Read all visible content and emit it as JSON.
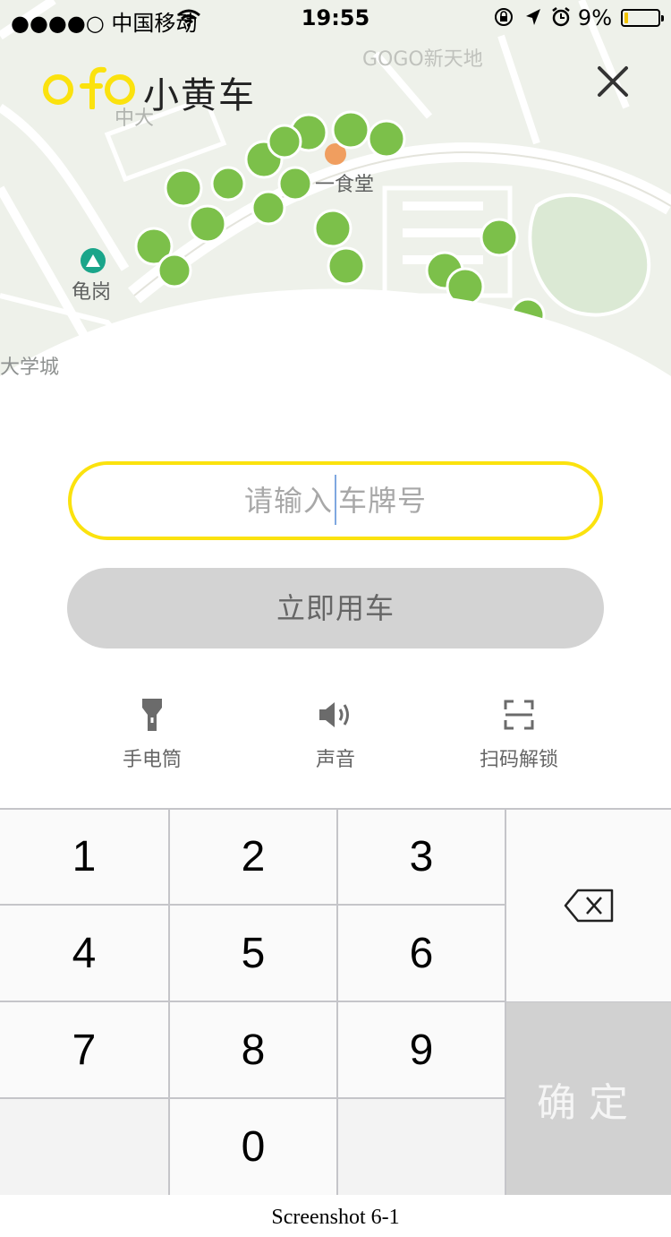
{
  "status_bar": {
    "carrier": "●●●●○ 中国移动",
    "time": "19:55",
    "battery_pct": "9%"
  },
  "brand": {
    "name": "小黄车",
    "accent": "#fbe20e"
  },
  "map": {
    "labels": {
      "gogo": "GOGO新天地",
      "zhongda": "中大",
      "canteen": "一食堂",
      "guigang": "龟岗",
      "school": "大学城"
    }
  },
  "input": {
    "placeholder_a": "请输入",
    "placeholder_b": "车牌号"
  },
  "ride_button": "立即用车",
  "tools": [
    {
      "icon": "flashlight-icon",
      "label": "手电筒"
    },
    {
      "icon": "speaker-icon",
      "label": "声音"
    },
    {
      "icon": "scan-icon",
      "label": "扫码解锁"
    }
  ],
  "keypad": {
    "keys": [
      "1",
      "2",
      "3",
      "4",
      "5",
      "6",
      "7",
      "8",
      "9",
      "0"
    ],
    "confirm": "确定"
  },
  "caption": "Screenshot 6-1"
}
